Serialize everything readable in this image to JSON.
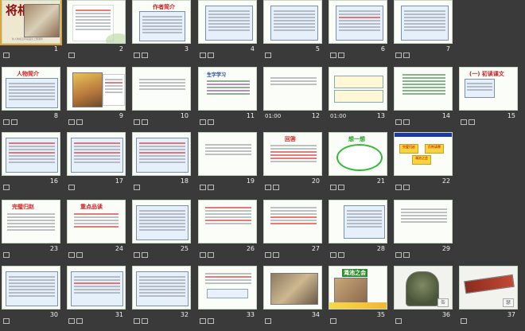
{
  "app": {
    "title": "将相和"
  },
  "slides": [
    {
      "n": "1",
      "kind": "cover",
      "title": "将相和",
      "caption": "新人教版五年级语文上册课件",
      "selected": true
    },
    {
      "n": "2",
      "kind": "text"
    },
    {
      "n": "3",
      "kind": "text",
      "heading": "作者简介"
    },
    {
      "n": "4",
      "kind": "text"
    },
    {
      "n": "5",
      "kind": "text"
    },
    {
      "n": "6",
      "kind": "text"
    },
    {
      "n": "7",
      "kind": "text"
    },
    {
      "n": "8",
      "kind": "text",
      "heading": "人物简介"
    },
    {
      "n": "9",
      "kind": "image"
    },
    {
      "n": "10",
      "kind": "text"
    },
    {
      "n": "11",
      "kind": "text",
      "heading": "生字学习"
    },
    {
      "n": "12",
      "kind": "text",
      "time": "01:00"
    },
    {
      "n": "13",
      "kind": "text",
      "time": "01:00"
    },
    {
      "n": "14",
      "kind": "text"
    },
    {
      "n": "15",
      "kind": "text",
      "heading": "(一) 初读课文"
    },
    {
      "n": "16",
      "kind": "text"
    },
    {
      "n": "17",
      "kind": "text"
    },
    {
      "n": "18",
      "kind": "text"
    },
    {
      "n": "19",
      "kind": "text"
    },
    {
      "n": "20",
      "kind": "text",
      "heading": "回答"
    },
    {
      "n": "21",
      "kind": "bubble",
      "heading": "想一想"
    },
    {
      "n": "22",
      "kind": "boxes",
      "labels": [
        "完璧归赵",
        "负荆请罪",
        "渑池之会"
      ]
    },
    {
      "n": "23",
      "kind": "text",
      "heading": "完璧归赵"
    },
    {
      "n": "24",
      "kind": "text",
      "heading": "重点品读"
    },
    {
      "n": "25",
      "kind": "text"
    },
    {
      "n": "26",
      "kind": "text"
    },
    {
      "n": "27",
      "kind": "text"
    },
    {
      "n": "28",
      "kind": "text"
    },
    {
      "n": "29",
      "kind": "text"
    },
    {
      "n": "30",
      "kind": "text"
    },
    {
      "n": "31",
      "kind": "text"
    },
    {
      "n": "32",
      "kind": "text"
    },
    {
      "n": "33",
      "kind": "text"
    },
    {
      "n": "34",
      "kind": "text"
    },
    {
      "n": "35",
      "kind": "text",
      "heading": "渑池之会"
    },
    {
      "n": "36",
      "kind": "image",
      "tag": "缶"
    },
    {
      "n": "37",
      "kind": "image",
      "tag": "瑟"
    }
  ],
  "icons": {
    "slide_transition": "transition-icon",
    "slide_animation": "animation-icon"
  }
}
